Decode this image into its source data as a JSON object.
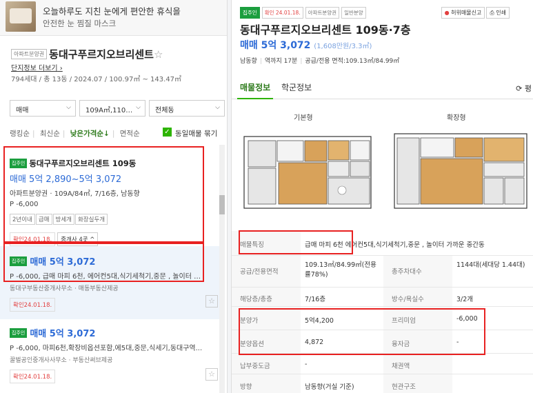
{
  "ad": {
    "title": "오늘하루도 지친 눈에게 편안한 휴식을",
    "subtitle": "안전한 눈 찜질 마스크"
  },
  "complex": {
    "tag": "아파트분양권",
    "name": "동대구푸르지오브리센트",
    "link": "단지정보 더보기",
    "info": "794세대 / 총 13동 / 2024.07 / 100.97㎡ ~ 143.47㎡"
  },
  "filters": {
    "deal": "매매",
    "area": "109A㎡,110…",
    "building": "전체동"
  },
  "sort": {
    "options": [
      "랭킹순",
      "최신순",
      "낮은가격순↓",
      "면적순"
    ],
    "active_index": 2,
    "same_listing_label": "동일매물 묶기",
    "same_listing_checked": true
  },
  "listings": [
    {
      "badge": "집주인",
      "name": "동대구푸르지오브리센트 109동",
      "price": "매매 5억 2,890~5억 3,072",
      "spec": "아파트분양권 · 109A/84㎡, 7/16층, 남동향",
      "premium": "P -6,000",
      "chips": [
        "2년이내",
        "급매",
        "방세개",
        "화장실두개"
      ],
      "confirmed": "확인24.01.18.",
      "agents": "중개사 4곳"
    },
    {
      "badge": "집주인",
      "price": "매매 5억 3,072",
      "spec": "P -6,000, 급매 마피 6천, 에어컨5대,식기세척기,중문 , 놀이터 …",
      "sub": "동대구부동산중개사무소 · 매동부동산제공",
      "confirmed": "확인24.01.18."
    },
    {
      "badge": "집주인",
      "price": "매매 5억 3,072",
      "spec": "P -6,000, 마피6천,확장비옵션포함,에5대,중문,식세기,동대구역...",
      "sub": "꿀벌공인중개사사무소 · 부동산써브제공",
      "confirmed": "확인24.01.18."
    }
  ],
  "detail": {
    "tags": [
      "집주인",
      "확인 24.01.18.",
      "아파트분양권",
      "일반분양"
    ],
    "buttons": {
      "report": "허위매물신고",
      "print": "인쇄"
    },
    "title": "동대구푸르지오브리센트 109동·7층",
    "price": "매매 5억 3,072",
    "price_per": "(1,608만원/3.3㎡)",
    "meta": [
      "남동향",
      "역까지 17분",
      "공급/전용 면적:109.13㎡/84.99㎡"
    ],
    "tabs": [
      "매물정보",
      "학군정보"
    ],
    "rotate_label": "평",
    "plans": {
      "basic": "기본형",
      "extended": "확장형"
    },
    "rows": [
      {
        "k": "매물특징",
        "v": "급매 마피 6천 에어컨5대,식기세척기,중문 , 놀이터 가까운 중간동"
      },
      {
        "k": "공급/전용면적",
        "v": "109.13㎡/84.99㎡(전용률78%)",
        "k2": "총주차대수",
        "v2": "1144대(세대당 1.44대)"
      },
      {
        "k": "해당층/총층",
        "v": "7/16층",
        "k2": "방수/욕실수",
        "v2": "3/2개"
      },
      {
        "k": "분양가",
        "v": "5억4,200",
        "k2": "프리미엄",
        "v2": "-6,000"
      },
      {
        "k": "분양옵션",
        "v": "4,872",
        "k2": "융자금",
        "v2": "-"
      },
      {
        "k": "납부중도금",
        "v": "-",
        "k2": "채권액",
        "v2": ""
      },
      {
        "k": "방향",
        "v": "남동향(거실 기준)",
        "k2": "현관구조",
        "v2": ""
      }
    ]
  }
}
